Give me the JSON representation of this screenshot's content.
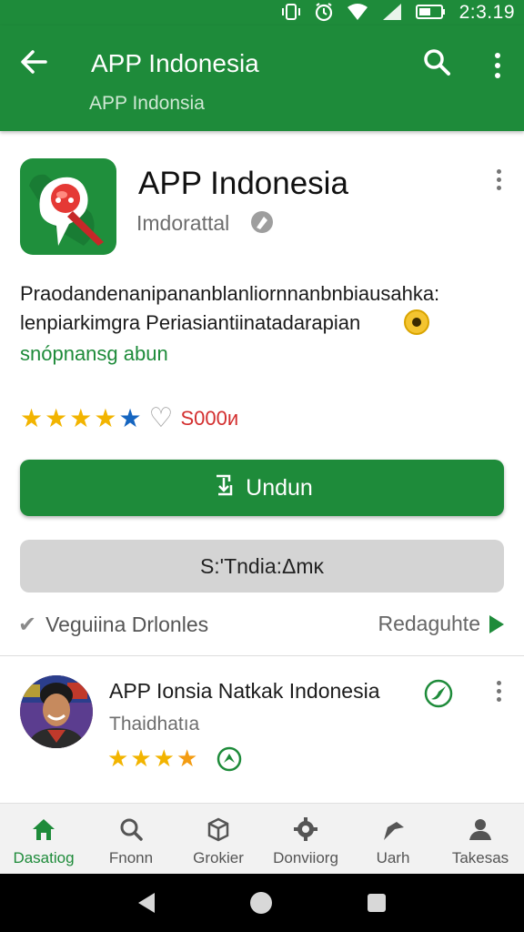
{
  "status_bar": {
    "time": "2:3.19"
  },
  "app_bar": {
    "title": "APP Indonesia",
    "subtitle": "APP Indonsia"
  },
  "app": {
    "name": "APP Indonesia",
    "developer": "Imdorattal",
    "description_line1": "Praodandenanipananblanliornnanbnbiausahka:",
    "description_line2": "lenpiarkimgra Periasiantiinatadarapian",
    "link_text": "snópnansg abun",
    "rating_count": "S000и",
    "stars_filled": 4,
    "install_label": "Undun",
    "secondary_label": "S:'Tndia:Δmĸ",
    "verify_label": "Veguiina Drlonles",
    "related_label": "Redaguhte"
  },
  "review": {
    "title": "APP Ionsia Natkak Indonesia",
    "subtitle": "Thaidhatıa",
    "stars": 4
  },
  "bottom_nav": [
    {
      "label": "Dasatiog",
      "icon": "home-icon"
    },
    {
      "label": "Fnonn",
      "icon": "search-icon"
    },
    {
      "label": "Grokier",
      "icon": "box-icon"
    },
    {
      "label": "Donviiorg",
      "icon": "gear-icon"
    },
    {
      "label": "Uarh",
      "icon": "share-icon"
    },
    {
      "label": "Takesas",
      "icon": "person-icon"
    }
  ],
  "colors": {
    "primary": "#1e8b3a",
    "accent_star": "#f2b400",
    "rating_red": "#d32f2f"
  }
}
